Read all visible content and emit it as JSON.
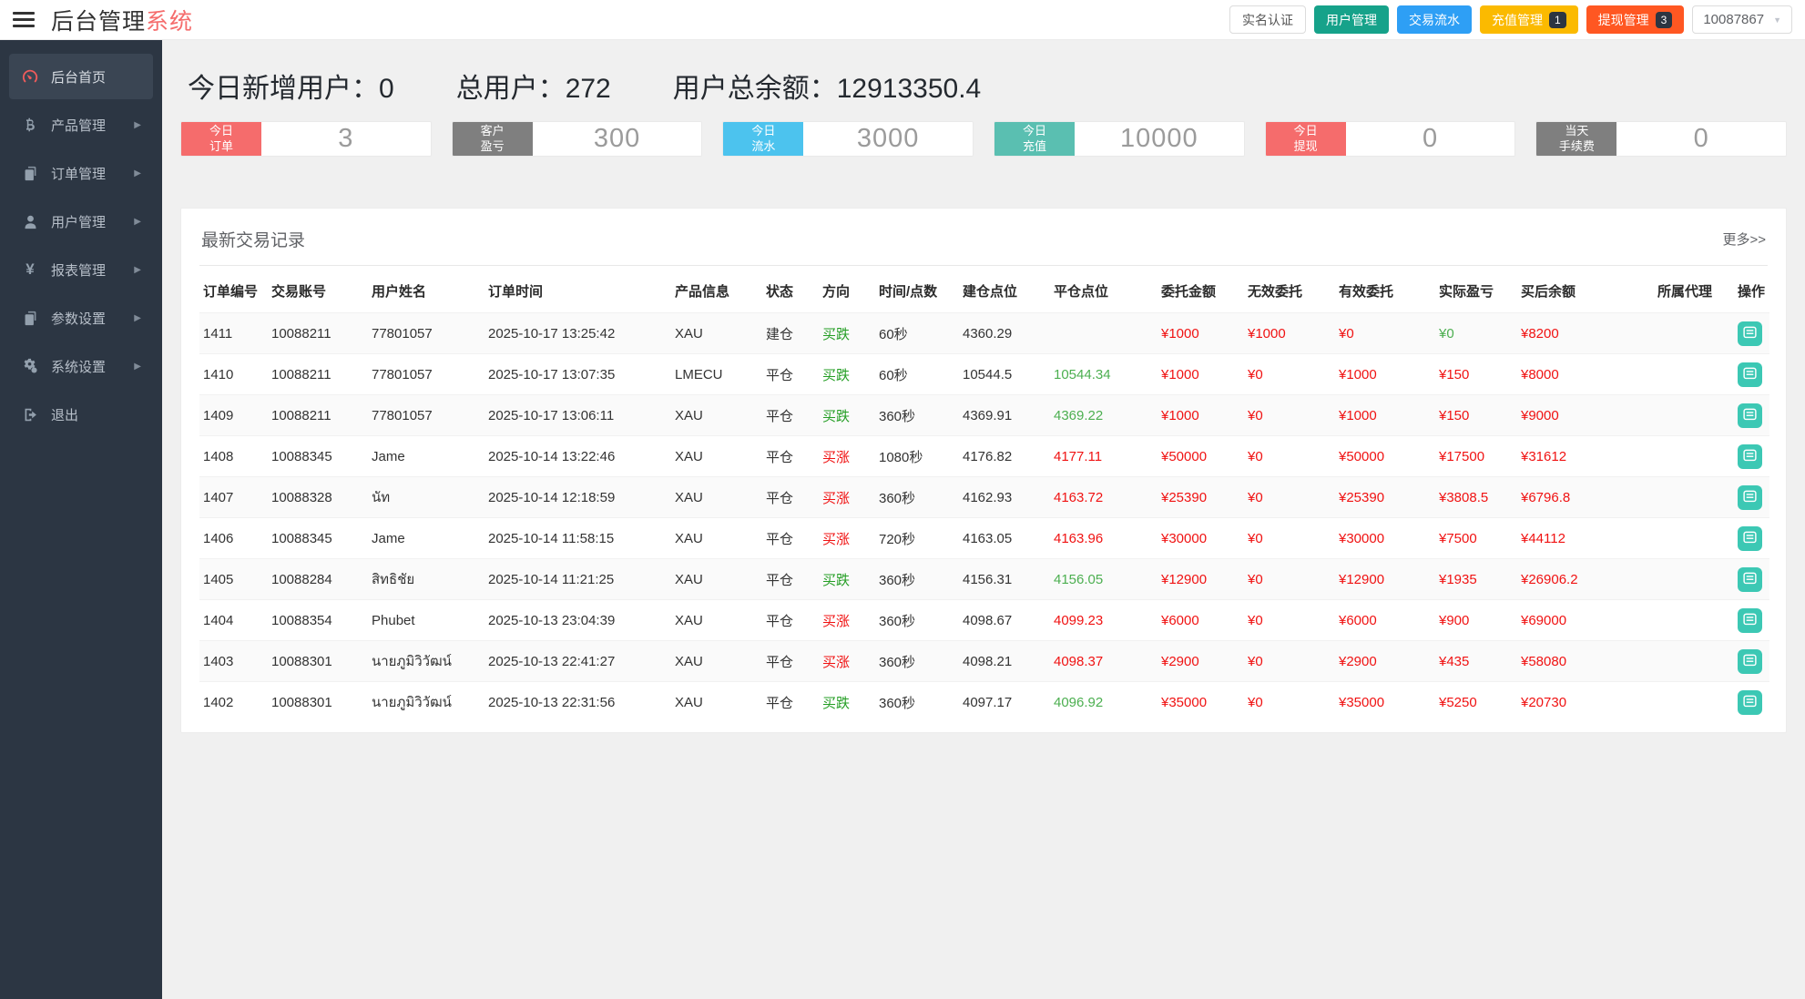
{
  "header": {
    "title_black": "后台管理",
    "title_red": "系统",
    "buttons": [
      {
        "key": "realname",
        "label": "实名认证",
        "style": "plain",
        "color": "#ffffff"
      },
      {
        "key": "users",
        "label": "用户管理",
        "style": "solid",
        "color": "#16a28a"
      },
      {
        "key": "trades",
        "label": "交易流水",
        "style": "solid",
        "color": "#2e9ff5"
      },
      {
        "key": "recharge",
        "label": "充值管理",
        "style": "solid",
        "color": "#fbba00",
        "badge": "1"
      },
      {
        "key": "withdraw",
        "label": "提现管理",
        "style": "solid",
        "color": "#ff5722",
        "badge": "3"
      }
    ],
    "account": "10087867",
    "caret_icon": "▼"
  },
  "sidebar": {
    "items": [
      {
        "key": "home",
        "label": "后台首页",
        "icon": "dashboard-icon",
        "active": true,
        "chevron": false
      },
      {
        "key": "products",
        "label": "产品管理",
        "icon": "bitcoin-icon",
        "active": false,
        "chevron": true
      },
      {
        "key": "orders",
        "label": "订单管理",
        "icon": "orders-icon",
        "active": false,
        "chevron": true
      },
      {
        "key": "users",
        "label": "用户管理",
        "icon": "user-icon",
        "active": false,
        "chevron": true
      },
      {
        "key": "reports",
        "label": "报表管理",
        "icon": "yen-icon",
        "active": false,
        "chevron": true
      },
      {
        "key": "params",
        "label": "参数设置",
        "icon": "params-icon",
        "active": false,
        "chevron": true
      },
      {
        "key": "system",
        "label": "系统设置",
        "icon": "gears-icon",
        "active": false,
        "chevron": true
      },
      {
        "key": "logout",
        "label": "退出",
        "icon": "logout-icon",
        "active": false,
        "chevron": false
      }
    ],
    "chevron_icon": "▶"
  },
  "stats": {
    "new_users_label": "今日新增用户：",
    "new_users_value": "0",
    "total_users_label": "总用户：",
    "total_users_value": "272",
    "total_balance_label": "用户总余额：",
    "total_balance_value": "12913350.4"
  },
  "stat_boxes": [
    {
      "line1": "今日",
      "line2": "订单",
      "value": "3",
      "color": "#f56c6c"
    },
    {
      "line1": "客户",
      "line2": "盈亏",
      "value": "300",
      "color": "#7f7f7f"
    },
    {
      "line1": "今日",
      "line2": "流水",
      "value": "3000",
      "color": "#4cc3ee"
    },
    {
      "line1": "今日",
      "line2": "充值",
      "value": "10000",
      "color": "#5abfb1"
    },
    {
      "line1": "今日",
      "line2": "提现",
      "value": "0",
      "color": "#f56c6c"
    },
    {
      "line1": "当天",
      "line2": "手续费",
      "value": "0",
      "color": "#7f7f7f"
    }
  ],
  "panel": {
    "title": "最新交易记录",
    "more": "更多>>",
    "columns": [
      "订单编号",
      "交易账号",
      "用户姓名",
      "订单时间",
      "产品信息",
      "状态",
      "方向",
      "时间/点数",
      "建仓点位",
      "平仓点位",
      "委托金额",
      "无效委托",
      "有效委托",
      "实际盈亏",
      "买后余额",
      "所属代理",
      "操作"
    ],
    "rows": [
      {
        "id": "1411",
        "account": "10088211",
        "name": "77801057",
        "time": "2025-10-17 13:25:42",
        "product": "XAU",
        "status": "建仓",
        "direction": "买跌",
        "dir_color": "green",
        "duration": "60秒",
        "open": "4360.29",
        "close": "",
        "close_color": "",
        "amount": "¥1000",
        "invalid": "¥1000",
        "valid": "¥0",
        "profit": "¥0",
        "profit_color": "green",
        "balance": "¥8200",
        "agent": ""
      },
      {
        "id": "1410",
        "account": "10088211",
        "name": "77801057",
        "time": "2025-10-17 13:07:35",
        "product": "LMECU",
        "status": "平仓",
        "direction": "买跌",
        "dir_color": "green",
        "duration": "60秒",
        "open": "10544.5",
        "close": "10544.34",
        "close_color": "green",
        "amount": "¥1000",
        "invalid": "¥0",
        "valid": "¥1000",
        "profit": "¥150",
        "profit_color": "red",
        "balance": "¥8000",
        "agent": ""
      },
      {
        "id": "1409",
        "account": "10088211",
        "name": "77801057",
        "time": "2025-10-17 13:06:11",
        "product": "XAU",
        "status": "平仓",
        "direction": "买跌",
        "dir_color": "green",
        "duration": "360秒",
        "open": "4369.91",
        "close": "4369.22",
        "close_color": "green",
        "amount": "¥1000",
        "invalid": "¥0",
        "valid": "¥1000",
        "profit": "¥150",
        "profit_color": "red",
        "balance": "¥9000",
        "agent": ""
      },
      {
        "id": "1408",
        "account": "10088345",
        "name": "Jame",
        "time": "2025-10-14 13:22:46",
        "product": "XAU",
        "status": "平仓",
        "direction": "买涨",
        "dir_color": "red",
        "duration": "1080秒",
        "open": "4176.82",
        "close": "4177.11",
        "close_color": "red",
        "amount": "¥50000",
        "invalid": "¥0",
        "valid": "¥50000",
        "profit": "¥17500",
        "profit_color": "red",
        "balance": "¥31612",
        "agent": ""
      },
      {
        "id": "1407",
        "account": "10088328",
        "name": "นัท",
        "time": "2025-10-14 12:18:59",
        "product": "XAU",
        "status": "平仓",
        "direction": "买涨",
        "dir_color": "red",
        "duration": "360秒",
        "open": "4162.93",
        "close": "4163.72",
        "close_color": "red",
        "amount": "¥25390",
        "invalid": "¥0",
        "valid": "¥25390",
        "profit": "¥3808.5",
        "profit_color": "red",
        "balance": "¥6796.8",
        "agent": ""
      },
      {
        "id": "1406",
        "account": "10088345",
        "name": "Jame",
        "time": "2025-10-14 11:58:15",
        "product": "XAU",
        "status": "平仓",
        "direction": "买涨",
        "dir_color": "red",
        "duration": "720秒",
        "open": "4163.05",
        "close": "4163.96",
        "close_color": "red",
        "amount": "¥30000",
        "invalid": "¥0",
        "valid": "¥30000",
        "profit": "¥7500",
        "profit_color": "red",
        "balance": "¥44112",
        "agent": ""
      },
      {
        "id": "1405",
        "account": "10088284",
        "name": "สิทธิชัย",
        "time": "2025-10-14 11:21:25",
        "product": "XAU",
        "status": "平仓",
        "direction": "买跌",
        "dir_color": "green",
        "duration": "360秒",
        "open": "4156.31",
        "close": "4156.05",
        "close_color": "green",
        "amount": "¥12900",
        "invalid": "¥0",
        "valid": "¥12900",
        "profit": "¥1935",
        "profit_color": "red",
        "balance": "¥26906.2",
        "agent": ""
      },
      {
        "id": "1404",
        "account": "10088354",
        "name": "Phubet",
        "time": "2025-10-13 23:04:39",
        "product": "XAU",
        "status": "平仓",
        "direction": "买涨",
        "dir_color": "red",
        "duration": "360秒",
        "open": "4098.67",
        "close": "4099.23",
        "close_color": "red",
        "amount": "¥6000",
        "invalid": "¥0",
        "valid": "¥6000",
        "profit": "¥900",
        "profit_color": "red",
        "balance": "¥69000",
        "agent": ""
      },
      {
        "id": "1403",
        "account": "10088301",
        "name": "นายภูมิวิวัฒน์",
        "time": "2025-10-13 22:41:27",
        "product": "XAU",
        "status": "平仓",
        "direction": "买涨",
        "dir_color": "red",
        "duration": "360秒",
        "open": "4098.21",
        "close": "4098.37",
        "close_color": "red",
        "amount": "¥2900",
        "invalid": "¥0",
        "valid": "¥2900",
        "profit": "¥435",
        "profit_color": "red",
        "balance": "¥58080",
        "agent": ""
      },
      {
        "id": "1402",
        "account": "10088301",
        "name": "นายภูมิวิวัฒน์",
        "time": "2025-10-13 22:31:56",
        "product": "XAU",
        "status": "平仓",
        "direction": "买跌",
        "dir_color": "green",
        "duration": "360秒",
        "open": "4097.17",
        "close": "4096.92",
        "close_color": "green",
        "amount": "¥35000",
        "invalid": "¥0",
        "valid": "¥35000",
        "profit": "¥5250",
        "profit_color": "red",
        "balance": "¥20730",
        "agent": ""
      }
    ]
  },
  "colors": {
    "red_text": "#f01212",
    "direction_green": "#249e24",
    "price_green": "#4caf50",
    "brand_red": "#f56c6c",
    "teal_button": "#16a28a",
    "blue_button": "#2e9ff5",
    "yellow_button": "#fbba00",
    "orange_button": "#ff5722",
    "sidebar_bg": "#2c3643",
    "action_button": "#3cc8b4"
  }
}
